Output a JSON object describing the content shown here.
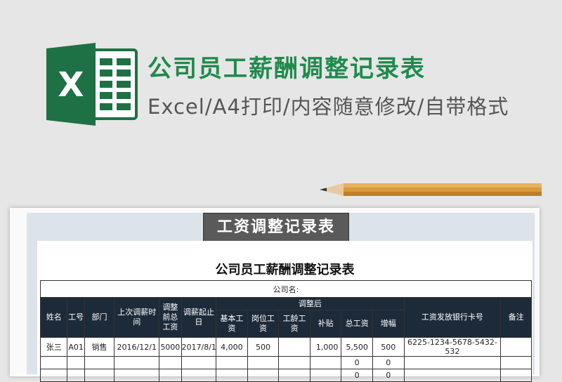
{
  "header": {
    "title": "公司员工薪酬调整记录表",
    "subtitle": "Excel/A4打印/内容随意修改/自带格式",
    "logo_letter": "X"
  },
  "sheet": {
    "banner": "工资调整记录表",
    "title": "公司员工薪酬调整记录表",
    "company_label": "公司名:",
    "headers": {
      "name": "姓名",
      "id": "工号",
      "dept": "部门",
      "last_time": "上次调薪时间",
      "pre_total": "调整前总工资",
      "period": "调薪起止日",
      "after_group": "调整后",
      "base": "基本工资",
      "post": "岗位工资",
      "seniority": "工龄工资",
      "allowance": "补贴",
      "total": "总工资",
      "increase": "增幅",
      "bank": "工资发放银行卡号",
      "note": "备注"
    },
    "rows": [
      {
        "name": "张三",
        "id": "A01",
        "dept": "销售",
        "last_time": "2016/12/1",
        "pre_total": "5000",
        "period": "2017/8/1",
        "base": "4,000",
        "post": "500",
        "seniority": "",
        "allowance": "1,000",
        "total": "5,500",
        "increase": "500",
        "bank": "6225-1234-5678-5432-532",
        "note": ""
      },
      {
        "name": "",
        "id": "",
        "dept": "",
        "last_time": "",
        "pre_total": "",
        "period": "",
        "base": "",
        "post": "",
        "seniority": "",
        "allowance": "",
        "total": "0",
        "increase": "0",
        "bank": "",
        "note": ""
      },
      {
        "name": "",
        "id": "",
        "dept": "",
        "last_time": "",
        "pre_total": "",
        "period": "",
        "base": "",
        "post": "",
        "seniority": "",
        "allowance": "",
        "total": "0",
        "increase": "0",
        "bank": "",
        "note": ""
      }
    ]
  },
  "colors": {
    "title_green": "#1f8a4c",
    "header_dark": "#1d2a3a",
    "excel_green": "#1e7145"
  }
}
